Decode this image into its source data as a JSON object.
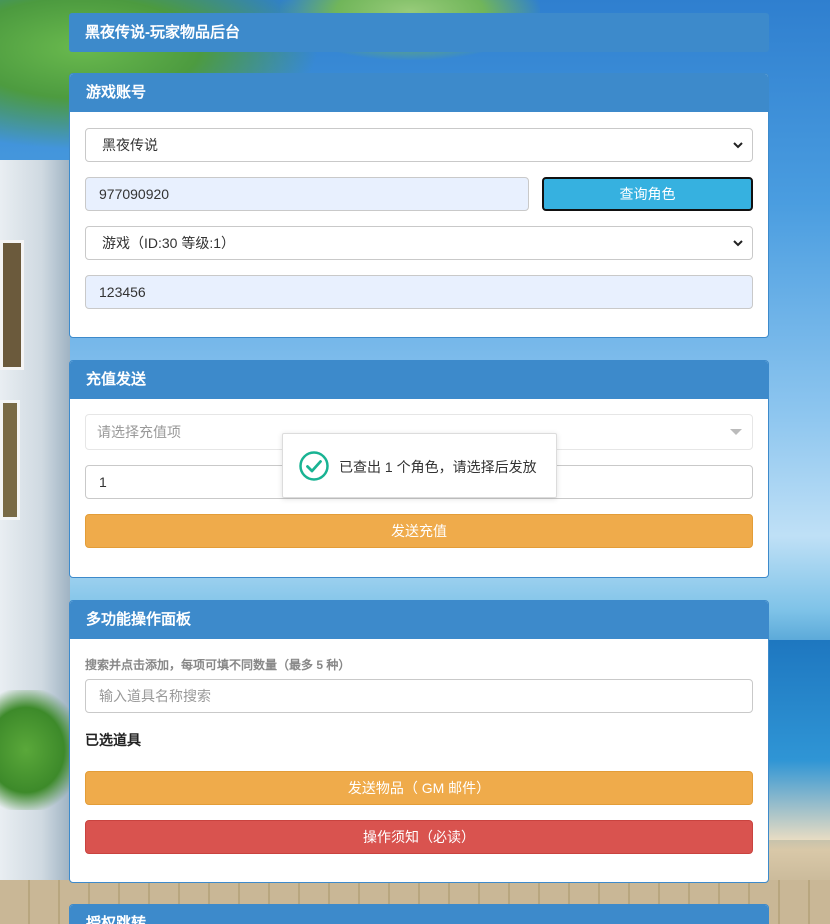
{
  "app": {
    "title": "黑夜传说-玩家物品后台"
  },
  "account_panel": {
    "heading": "游戏账号",
    "game_select": "黑夜传说",
    "account_input": "977090920",
    "query_button": "查询角色",
    "role_select": "游戏（ID:30 等级:1）",
    "password_input": "123456"
  },
  "recharge_panel": {
    "heading": "充值发送",
    "item_select_placeholder": "请选择充值项",
    "quantity_input": "1",
    "send_button": "发送充值"
  },
  "toast": {
    "message": "已查出 1 个角色，请选择后发放",
    "icon": "check-circle-icon",
    "icon_color": "#19b393"
  },
  "multi_panel": {
    "heading": "多功能操作面板",
    "hint": "搜索并点击添加，每项可填不同数量（最多 5 种）",
    "search_placeholder": "输入道具名称搜索",
    "selected_label": "已选道具",
    "send_items_button": "发送物品（ GM 邮件）",
    "notice_button": "操作须知（必读）"
  },
  "next_panel": {
    "heading": "授权跳转"
  },
  "colors": {
    "panel_header": "#3d8acb",
    "query_button": "#36b1e0",
    "orange_button": "#efab4b",
    "red_button": "#d9534f",
    "input_filled": "#e8f0fe"
  }
}
